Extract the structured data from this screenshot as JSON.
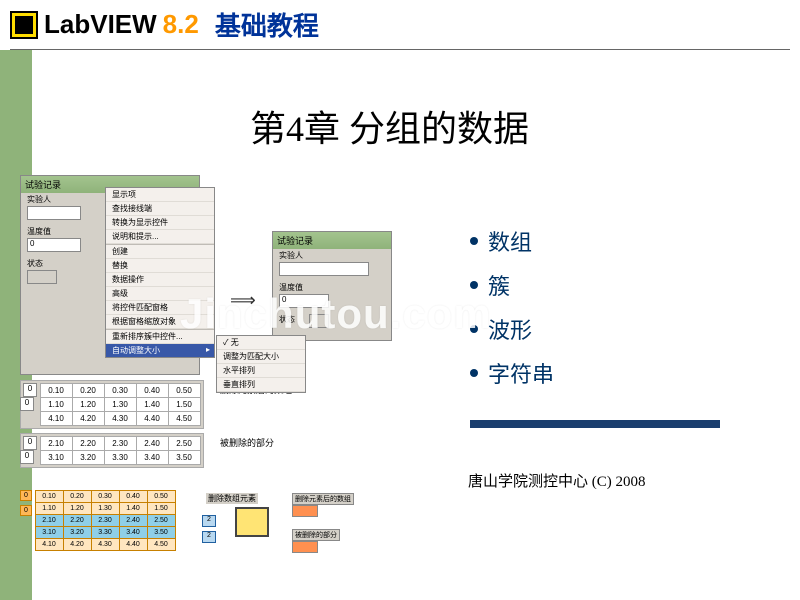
{
  "header": {
    "logo_text": "LabVIEW",
    "version": "8.2",
    "subtitle": "基础教程"
  },
  "chapter_title": "第4章 分组的数据",
  "topics": [
    "数组",
    "簇",
    "波形",
    "字符串"
  ],
  "footer": "唐山学院测控中心  (C)  2008",
  "watermark": "Jinchutou.com",
  "panel_a": {
    "title": "试验记录",
    "experimenter_label": "实验人",
    "temperature_label": "温度值",
    "temperature_value": "0",
    "status_label": "状态"
  },
  "context_menu": {
    "items_top": [
      "显示项",
      "查找接线端",
      "转换为显示控件",
      "说明和提示..."
    ],
    "items_mid": [
      "创建",
      "替换",
      "数据操作",
      "高级",
      "将控件匹配窗格",
      "根据窗格缩放对象"
    ],
    "items_bot": [
      "重新排序簇中控件..."
    ],
    "highlighted": "自动调整大小",
    "submenu": [
      "无",
      "调整为匹配大小",
      "水平排列",
      "垂直排列"
    ]
  },
  "arrow": "⟹",
  "array_labels": {
    "deleted_after": "删除元素后的数组",
    "deleted_part": "被删除的部分"
  },
  "array1": {
    "idx": [
      "0",
      "0"
    ],
    "rows": [
      [
        "0.10",
        "0.20",
        "0.30",
        "0.40",
        "0.50"
      ],
      [
        "1.10",
        "1.20",
        "1.30",
        "1.40",
        "1.50"
      ],
      [
        "4.10",
        "4.20",
        "4.30",
        "4.40",
        "4.50"
      ]
    ]
  },
  "array2": {
    "idx": [
      "0",
      "0"
    ],
    "rows": [
      [
        "2.10",
        "2.20",
        "2.30",
        "2.40",
        "2.50"
      ],
      [
        "3.10",
        "3.20",
        "3.30",
        "3.40",
        "3.50"
      ]
    ]
  },
  "bd": {
    "idx": [
      "0",
      "0"
    ],
    "rows": [
      [
        "0.10",
        "0.20",
        "0.30",
        "0.40",
        "0.50"
      ],
      [
        "1.10",
        "1.20",
        "1.30",
        "1.40",
        "1.50"
      ],
      [
        "2.10",
        "2.20",
        "2.30",
        "2.40",
        "2.50"
      ],
      [
        "3.10",
        "3.20",
        "3.30",
        "3.40",
        "3.50"
      ],
      [
        "4.10",
        "4.20",
        "4.30",
        "4.40",
        "4.50"
      ]
    ]
  },
  "node": {
    "label": "删除数组元素",
    "const1": "2",
    "const2": "2",
    "out1": "删除元素后的数组",
    "out2": "被删除的部分"
  }
}
